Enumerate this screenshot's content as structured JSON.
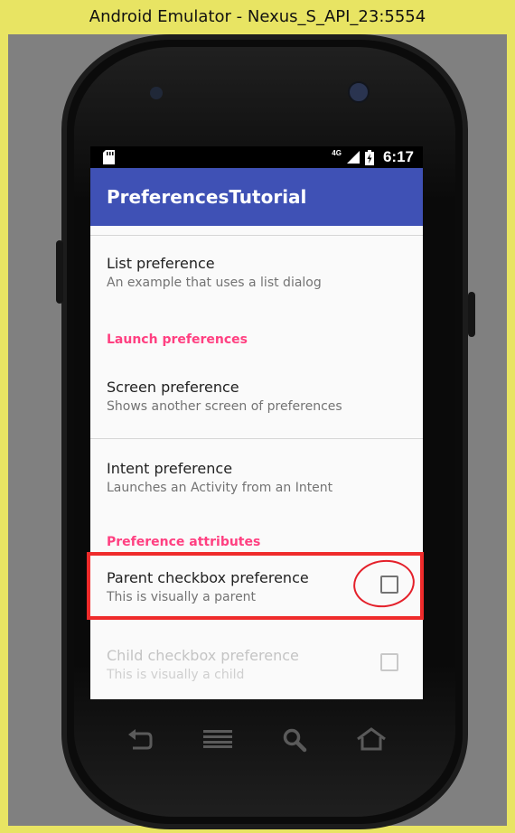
{
  "window": {
    "title": "Android Emulator - Nexus_S_API_23:5554"
  },
  "status_bar": {
    "network": "4G",
    "time": "6:17"
  },
  "app_bar": {
    "title": "PreferencesTutorial"
  },
  "preferences": {
    "list_pref": {
      "title": "List preference",
      "summary": "An example that uses a list dialog"
    },
    "category_launch": "Launch preferences",
    "screen_pref": {
      "title": "Screen preference",
      "summary": "Shows another screen of preferences"
    },
    "intent_pref": {
      "title": "Intent preference",
      "summary": "Launches an Activity from an Intent"
    },
    "category_attributes": "Preference attributes",
    "parent_checkbox": {
      "title": "Parent checkbox preference",
      "summary": "This is visually a parent",
      "checked": false
    },
    "child_checkbox": {
      "title": "Child checkbox preference",
      "summary": "This is visually a child",
      "checked": false,
      "enabled": false
    }
  },
  "colors": {
    "primary": "#3f51b5",
    "accent": "#ff4081",
    "annotation": "#ef2b2b"
  },
  "nav_icons": [
    "back-icon",
    "menu-icon",
    "search-icon",
    "home-icon"
  ]
}
